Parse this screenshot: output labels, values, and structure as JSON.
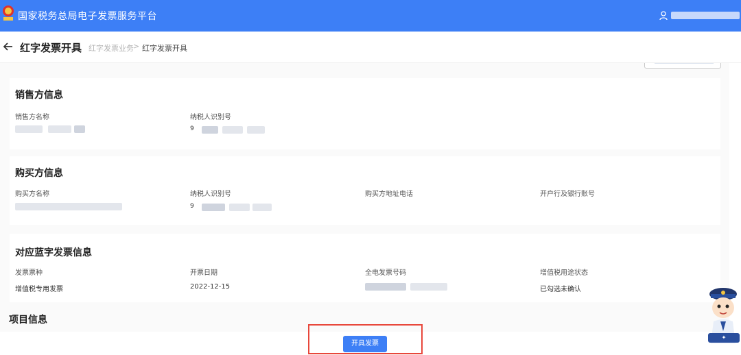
{
  "header": {
    "app_title": "国家税务总局电子发票服务平台",
    "brand_color": "#3d7ff6"
  },
  "subheader": {
    "page_title": "红字发票开具",
    "breadcrumb": [
      "红字发票业务",
      "红字发票开具"
    ],
    "breadcrumb_separator": ">"
  },
  "seller": {
    "title": "销售方信息",
    "name_label": "销售方名称",
    "tax_id_label": "纳税人识别号",
    "tax_id_prefix": "9"
  },
  "buyer": {
    "title": "购买方信息",
    "name_label": "购买方名称",
    "tax_id_label": "纳税人识别号",
    "tax_id_prefix": "9",
    "address_label": "购买方地址电话",
    "bank_label": "开户行及银行账号"
  },
  "blue_invoice": {
    "title": "对应蓝字发票信息",
    "type_label": "发票票种",
    "type_value": "增值税专用发票",
    "date_label": "开票日期",
    "date_value": "2022-12-15",
    "number_label": "全电发票号码",
    "status_label": "增值税用途状态",
    "status_value": "已勾选未确认"
  },
  "items": {
    "title": "项目信息"
  },
  "footer": {
    "submit_label": "开具发票",
    "highlight_color": "#e8473b"
  },
  "icons": [
    "emblem-icon",
    "user-icon",
    "back-arrow-icon",
    "mascot-icon"
  ]
}
